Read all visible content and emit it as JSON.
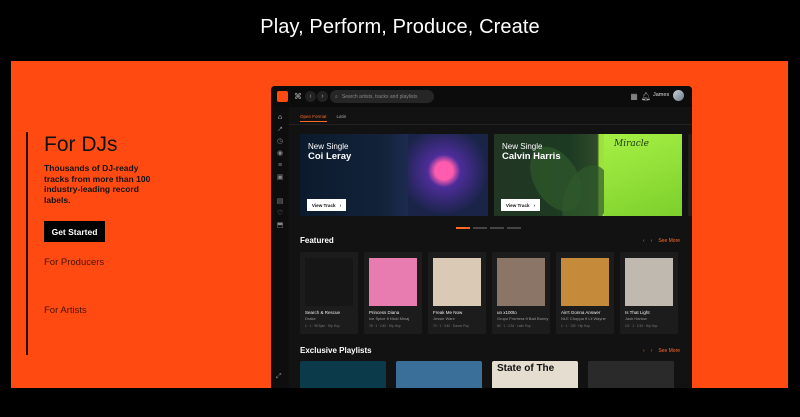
{
  "hero": {
    "title": "Play, Perform, Produce, Create"
  },
  "left_nav": {
    "active_title": "For DJs",
    "active_description": "Thousands of DJ-ready tracks from more than 100 industry-leading record labels.",
    "cta_label": "Get Started",
    "items": [
      "For Producers",
      "For Artists"
    ]
  },
  "app": {
    "search_placeholder": "Search artists, tracks and playlists",
    "user_name": "James",
    "tabs": [
      "Open Format",
      "Latin"
    ],
    "banners": [
      {
        "kicker": "New Single",
        "artist": "Coi Leray",
        "button": "View Track"
      },
      {
        "kicker": "New Single",
        "artist": "Calvin Harris",
        "button": "View Track",
        "art_title": "Miracle"
      }
    ],
    "featured": {
      "title": "Featured",
      "see_more": "See More",
      "cards": [
        {
          "title": "Search & Rescue",
          "artist": "Drake",
          "meta": "1 · 1 · 98 Bpm · Hip Hop",
          "color": "#161616"
        },
        {
          "title": "Princess Diana",
          "artist": "Ice Spice ft Nicki Minaj",
          "meta": "78 · 1 · 2:40 · Hip Hop",
          "color": "#e87bb0"
        },
        {
          "title": "Freak Me Now",
          "artist": "Jessie Ware",
          "meta": "70 · 1 · 3:40 · Dance Pop",
          "color": "#d9c9b5"
        },
        {
          "title": "un x100to",
          "artist": "Grupo Frontera ft Bad Bunny",
          "meta": "84 · 1 · 2:34 · Latin Pop",
          "color": "#8a7566"
        },
        {
          "title": "Ain't Gonna Answer",
          "artist": "NLE Choppa ft Lil Wayne",
          "meta": "1 · 1 · 130 · Hip Hop",
          "color": "#c58a3a"
        },
        {
          "title": "Is That Light",
          "artist": "Jack Harlow",
          "meta": "1/2 · 1 · 2:34 · Hip Hop",
          "color": "#bfb9b0"
        }
      ]
    },
    "playlists": {
      "title": "Exclusive Playlists",
      "see_more": "See More",
      "items": [
        {
          "text": "",
          "color": "#0b3b4a"
        },
        {
          "text": "",
          "color": "#3a6f99"
        },
        {
          "text": "State of The",
          "color": "#e4ddd0"
        },
        {
          "text": "",
          "color": "#2a2a2a"
        }
      ]
    }
  },
  "colors": {
    "brand": "#ff4b12",
    "accent": "#ff6a2b",
    "app_bg": "#121212"
  },
  "icons": [
    "logo-icon",
    "grid-icon",
    "back-icon",
    "forward-icon",
    "search-icon",
    "apps-icon",
    "bell-icon",
    "home-icon",
    "chart-icon",
    "clock-icon",
    "disc-icon",
    "playlist-icon",
    "image-icon",
    "library-icon",
    "heart-icon",
    "download-icon",
    "expand-icon"
  ]
}
